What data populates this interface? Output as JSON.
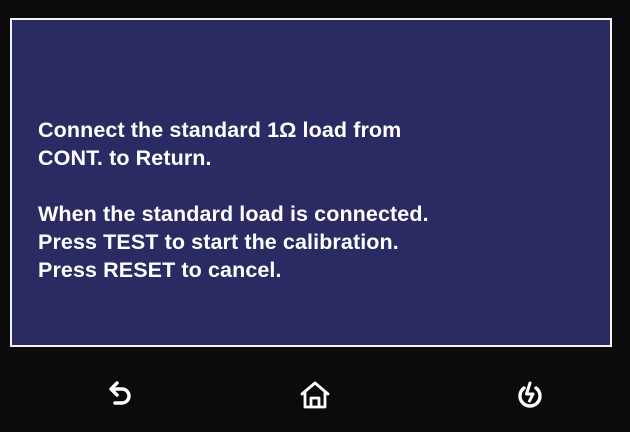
{
  "message": {
    "lines_top": [
      "Connect the standard 1Ω load from",
      "CONT. to Return."
    ],
    "lines_bottom": [
      "When the standard load is connected.",
      "Press TEST to start the calibration.",
      "Press RESET to cancel."
    ]
  },
  "nav": {
    "back_icon": "back-arrow-icon",
    "home_icon": "home-icon",
    "power_icon": "power-icon"
  },
  "colors": {
    "screen_bg": "#2b2b63",
    "frame": "#f4f4f6",
    "bar_bg": "#0b0b0d",
    "text": "#ffffff"
  }
}
